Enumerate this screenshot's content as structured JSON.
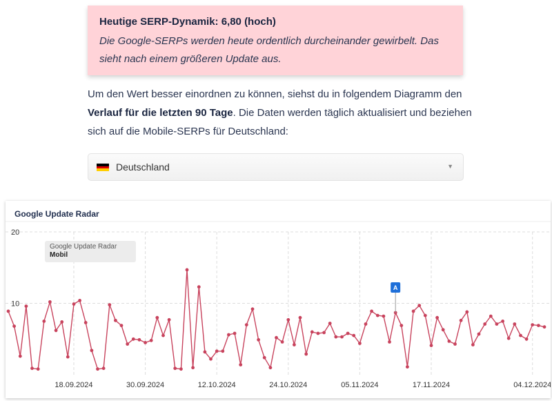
{
  "alert": {
    "title": "Heutige SERP-Dynamik: 6,80 (hoch)",
    "text": "Die Google-SERPs werden heute ordentlich durcheinander gewirbelt. Das sieht nach einem größeren Update aus."
  },
  "intro": {
    "part1": "Um den Wert besser einordnen zu können, siehst du in folgendem Diagramm den",
    "bold": "Verlauf für die letzten 90 Tage",
    "part2": ". Die Daten werden täglich aktualisiert und beziehen sich auf die Mobile-SERPs für Deutschland:"
  },
  "country_select": {
    "selected": "Deutschland",
    "flag_colors": [
      "#000000",
      "#dd0000",
      "#ffce00"
    ]
  },
  "colors": {
    "series": "#c8435d",
    "annotation": "#1e6fd9"
  },
  "chart_data": {
    "type": "line",
    "title": "Google Update Radar",
    "legend": {
      "title": "Google Update Radar",
      "series_label": "Mobil",
      "placement": "top-left"
    },
    "series": [
      {
        "name": "Mobil",
        "x": [
          "2024-09-07",
          "2024-09-08",
          "2024-09-09",
          "2024-09-10",
          "2024-09-11",
          "2024-09-12",
          "2024-09-13",
          "2024-09-14",
          "2024-09-15",
          "2024-09-16",
          "2024-09-17",
          "2024-09-18",
          "2024-09-19",
          "2024-09-20",
          "2024-09-21",
          "2024-09-22",
          "2024-09-23",
          "2024-09-24",
          "2024-09-25",
          "2024-09-26",
          "2024-09-27",
          "2024-09-28",
          "2024-09-29",
          "2024-09-30",
          "2024-10-01",
          "2024-10-02",
          "2024-10-03",
          "2024-10-04",
          "2024-10-05",
          "2024-10-06",
          "2024-10-07",
          "2024-10-08",
          "2024-10-09",
          "2024-10-10",
          "2024-10-11",
          "2024-10-12",
          "2024-10-13",
          "2024-10-14",
          "2024-10-15",
          "2024-10-16",
          "2024-10-17",
          "2024-10-18",
          "2024-10-19",
          "2024-10-20",
          "2024-10-21",
          "2024-10-22",
          "2024-10-23",
          "2024-10-24",
          "2024-10-25",
          "2024-10-26",
          "2024-10-27",
          "2024-10-28",
          "2024-10-29",
          "2024-10-30",
          "2024-10-31",
          "2024-11-01",
          "2024-11-02",
          "2024-11-03",
          "2024-11-04",
          "2024-11-05",
          "2024-11-06",
          "2024-11-07",
          "2024-11-08",
          "2024-11-09",
          "2024-11-10",
          "2024-11-11",
          "2024-11-12",
          "2024-11-13",
          "2024-11-14",
          "2024-11-15",
          "2024-11-16",
          "2024-11-17",
          "2024-11-18",
          "2024-11-19",
          "2024-11-20",
          "2024-11-21",
          "2024-11-22",
          "2024-11-23",
          "2024-11-24",
          "2024-11-25",
          "2024-11-26",
          "2024-11-27",
          "2024-11-28",
          "2024-11-29",
          "2024-11-30",
          "2024-12-01",
          "2024-12-02",
          "2024-12-03",
          "2024-12-04",
          "2024-12-05",
          "2024-12-06"
        ],
        "values": [
          8.9,
          6.8,
          2.6,
          9.6,
          0.9,
          0.8,
          7.5,
          10.2,
          6.2,
          7.4,
          2.5,
          9.9,
          10.4,
          7.3,
          3.4,
          0.8,
          0.9,
          9.8,
          7.6,
          6.9,
          4.3,
          5.0,
          4.9,
          4.5,
          4.8,
          8.0,
          5.5,
          7.7,
          0.9,
          0.8,
          14.7,
          1.0,
          12.3,
          3.2,
          2.2,
          3.3,
          3.3,
          5.6,
          5.8,
          1.4,
          7.0,
          9.2,
          4.9,
          2.4,
          1.0,
          5.2,
          4.6,
          7.7,
          4.2,
          8.0,
          2.9,
          6.0,
          5.8,
          5.9,
          7.2,
          5.3,
          5.3,
          5.8,
          5.5,
          4.4,
          7.1,
          8.9,
          8.3,
          8.2,
          4.6,
          8.7,
          6.9,
          1.1,
          8.9,
          9.7,
          8.3,
          4.1,
          8.0,
          6.3,
          4.7,
          4.3,
          7.6,
          8.8,
          4.2,
          5.7,
          7.1,
          8.2,
          7.1,
          7.5,
          5.1,
          7.1,
          5.5,
          5.0,
          7.0,
          6.9,
          6.7
        ]
      }
    ],
    "x_tick_labels": [
      "18.09.2024",
      "30.09.2024",
      "12.10.2024",
      "24.10.2024",
      "05.11.2024",
      "17.11.2024",
      "04.12.2024"
    ],
    "y_tick_labels": [
      "10",
      "20"
    ],
    "ylim": [
      0,
      20
    ],
    "grid": true,
    "annotations": [
      {
        "label": "A",
        "x": "2024-11-11"
      }
    ]
  }
}
